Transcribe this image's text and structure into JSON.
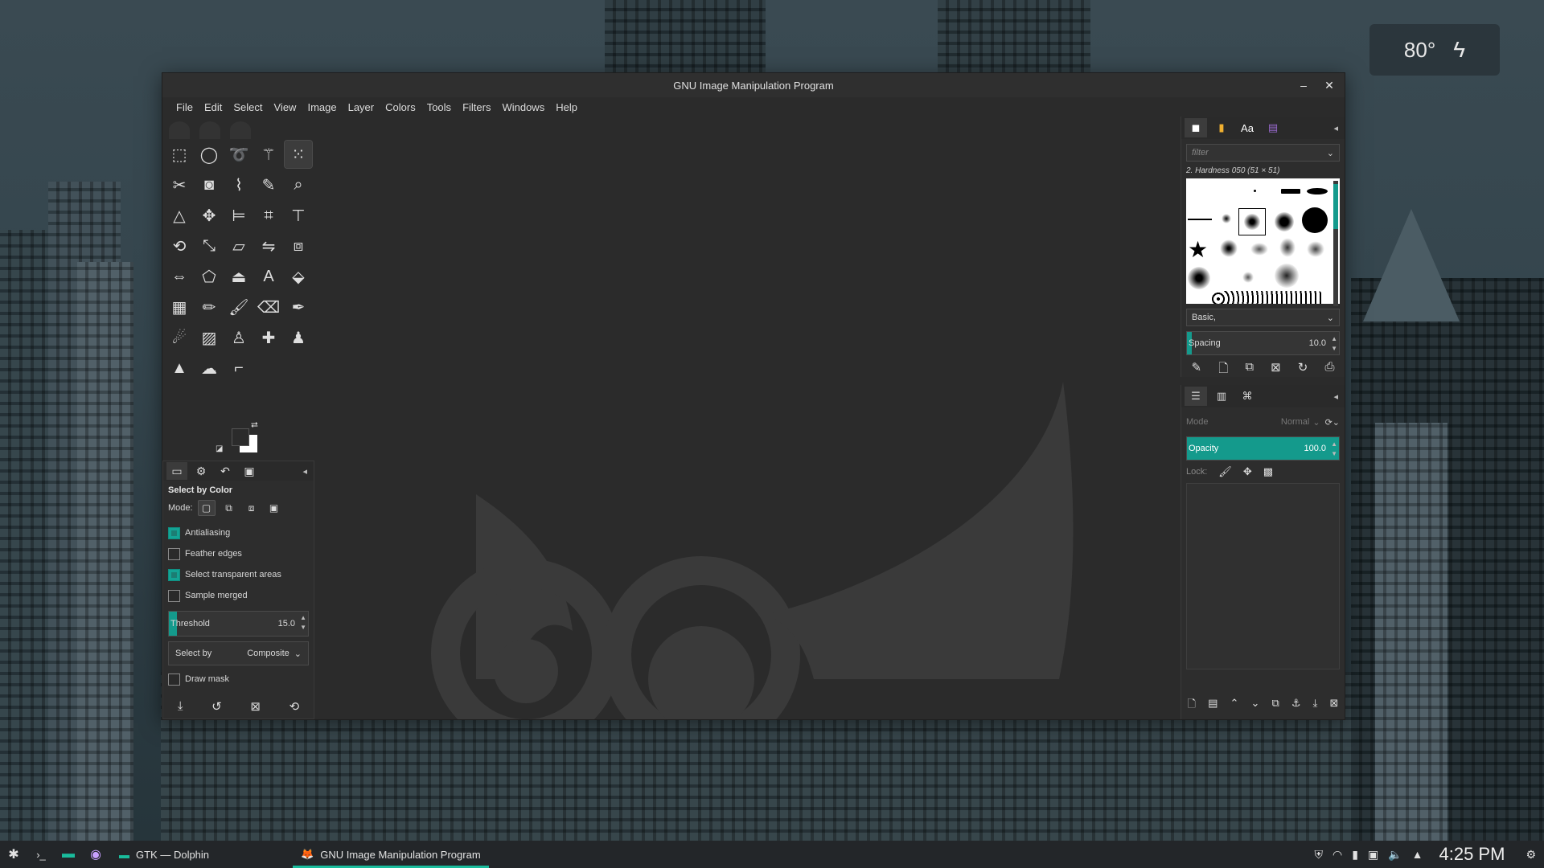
{
  "weather": {
    "temperature": "80°",
    "icon": "lightning-bolt-icon"
  },
  "window": {
    "title": "GNU Image Manipulation Program",
    "minimize": "–",
    "close": "✕"
  },
  "menu": [
    "File",
    "Edit",
    "Select",
    "View",
    "Image",
    "Layer",
    "Colors",
    "Tools",
    "Filters",
    "Windows",
    "Help"
  ],
  "tool_options": {
    "title": "Select by Color",
    "mode_label": "Mode:",
    "antialiasing": "Antialiasing",
    "feather_edges": "Feather edges",
    "select_transparent": "Select transparent areas",
    "sample_merged": "Sample merged",
    "threshold_label": "Threshold",
    "threshold_value": "15.0",
    "threshold_fraction": 0.06,
    "select_by_label": "Select by",
    "select_by_value": "Composite",
    "draw_mask": "Draw mask",
    "checks": {
      "antialiasing": true,
      "feather_edges": false,
      "select_transparent": true,
      "sample_merged": false,
      "draw_mask": false
    }
  },
  "brushes": {
    "filter_placeholder": "filter",
    "selected_brush": "2. Hardness 050 (51 × 51)",
    "preset": "Basic,",
    "spacing_label": "Spacing",
    "spacing_value": "10.0"
  },
  "layers": {
    "mode_label": "Mode",
    "mode_value": "Normal",
    "opacity_label": "Opacity",
    "opacity_value": "100.0",
    "lock_label": "Lock:"
  },
  "taskbar": {
    "tasks": [
      {
        "label": "GTK — Dolphin"
      },
      {
        "label": "GNU Image Manipulation Program"
      }
    ],
    "clock": "4:25 PM"
  },
  "colors": {
    "accent": "#14a394",
    "window_bg": "#2b2b2b",
    "taskbar_bg": "#232629"
  }
}
